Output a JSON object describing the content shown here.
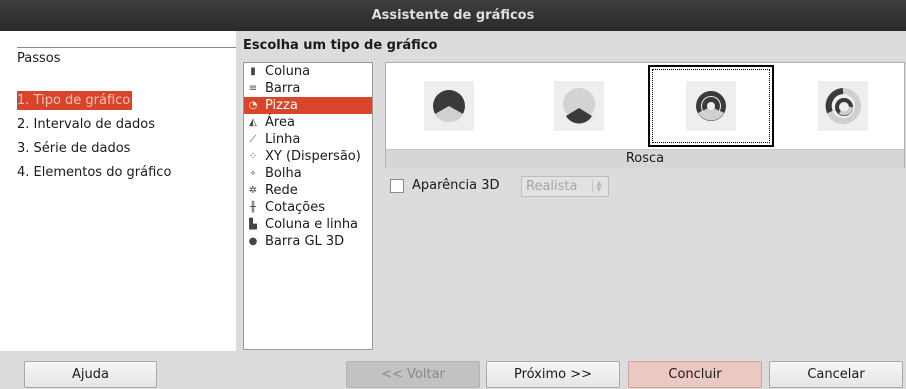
{
  "window": {
    "title": "Assistente de gráficos"
  },
  "steps": {
    "title": "Passos",
    "items": [
      {
        "label": "1. Tipo de gráfico",
        "active": true
      },
      {
        "label": "2. Intervalo de dados",
        "active": false
      },
      {
        "label": "3. Série de dados",
        "active": false
      },
      {
        "label": "4. Elementos do gráfico",
        "active": false
      }
    ]
  },
  "main": {
    "section_title": "Escolha um tipo de gráfico",
    "chart_types": [
      {
        "label": "Coluna",
        "icon": "column-chart-icon"
      },
      {
        "label": "Barra",
        "icon": "bar-chart-icon"
      },
      {
        "label": "Pizza",
        "icon": "pie-chart-icon",
        "selected": true
      },
      {
        "label": "Área",
        "icon": "area-chart-icon"
      },
      {
        "label": "Linha",
        "icon": "line-chart-icon"
      },
      {
        "label": "XY (Dispersão)",
        "icon": "scatter-chart-icon"
      },
      {
        "label": "Bolha",
        "icon": "bubble-chart-icon"
      },
      {
        "label": "Rede",
        "icon": "net-chart-icon"
      },
      {
        "label": "Cotações",
        "icon": "stock-chart-icon"
      },
      {
        "label": "Coluna e linha",
        "icon": "column-line-chart-icon"
      },
      {
        "label": "Barra GL 3D",
        "icon": "gl3d-bar-chart-icon"
      }
    ],
    "variants": [
      {
        "name": "normal-pie"
      },
      {
        "name": "exploded-pie"
      },
      {
        "name": "donut",
        "selected": true
      },
      {
        "name": "exploded-donut"
      }
    ],
    "selected_variant_label": "Rosca",
    "appearance_3d": {
      "label": "Aparência 3D",
      "checked": false
    },
    "appearance_combo": {
      "value": "Realista"
    }
  },
  "buttons": {
    "help": "Ajuda",
    "back": "<< Voltar",
    "next": "Próximo >>",
    "finish": "Concluir",
    "cancel": "Cancelar"
  },
  "colors": {
    "selection": "#d9452b",
    "titlebar": "#333333"
  }
}
